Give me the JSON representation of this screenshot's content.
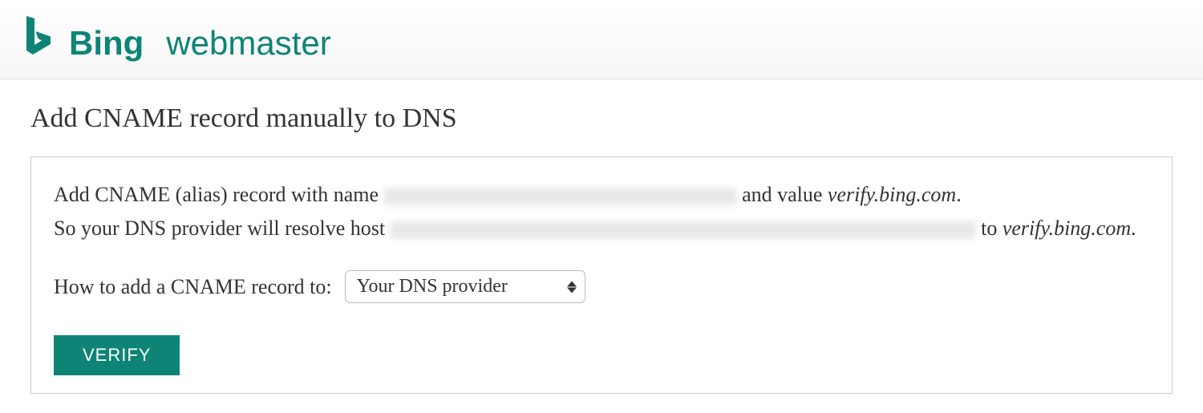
{
  "header": {
    "brand_name": "Bing",
    "product_name": "webmaster"
  },
  "page": {
    "title": "Add CNAME record manually to DNS"
  },
  "instructions": {
    "line1_prefix": "Add CNAME (alias) record with name ",
    "line1_mid": " and value ",
    "line1_value": "verify.bing.com",
    "line1_suffix": ".",
    "line2_prefix": "So your DNS provider will resolve host ",
    "line2_mid": " to ",
    "line2_value": "verify.bing.com",
    "line2_suffix": "."
  },
  "howto": {
    "label": "How to add a CNAME record to:",
    "selected_option": "Your DNS provider"
  },
  "actions": {
    "verify_label": "VERIFY"
  },
  "colors": {
    "brand": "#0e8476"
  }
}
